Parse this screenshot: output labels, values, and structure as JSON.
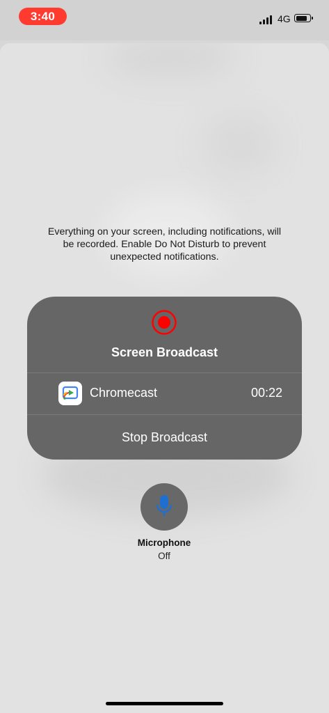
{
  "status_bar": {
    "time": "3:40",
    "network": "4G"
  },
  "warning_text": "Everything on your screen, including notifications, will be recorded. Enable Do Not Disturb to prevent unexpected notifications.",
  "broadcast": {
    "title": "Screen Broadcast",
    "app_name": "Chromecast",
    "elapsed": "00:22",
    "stop_label": "Stop Broadcast",
    "record_icon": "record-icon",
    "app_icon": "chromecast-app-icon"
  },
  "microphone": {
    "label": "Microphone",
    "state": "Off",
    "icon": "microphone-icon"
  },
  "colors": {
    "time_pill": "#ff3b30",
    "record_red": "#ff0000",
    "mic_blue": "#1f6fd1"
  }
}
